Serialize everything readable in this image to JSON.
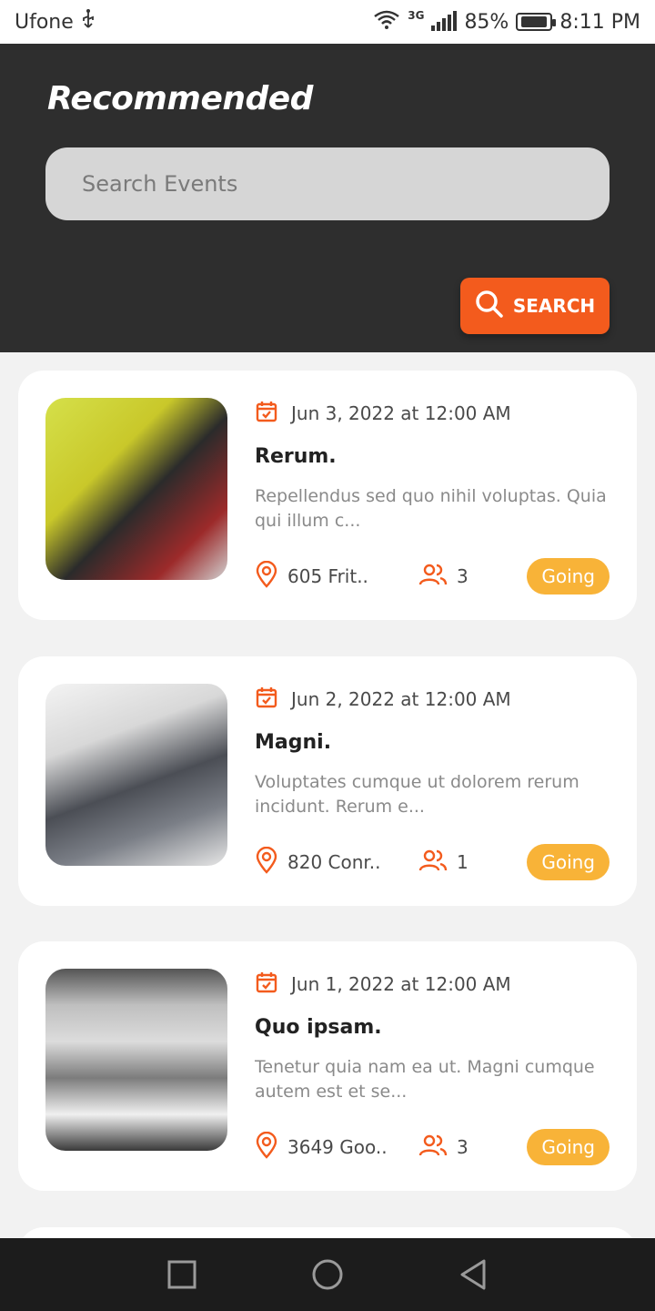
{
  "status_bar": {
    "carrier": "Ufone",
    "network": "3G",
    "battery": "85%",
    "time": "8:11 PM"
  },
  "header": {
    "title": "Recommended",
    "search_placeholder": "Search Events",
    "search_button": "SEARCH"
  },
  "events": [
    {
      "date": "Jun 3, 2022 at 12:00 AM",
      "title": "Rerum.",
      "description": "Repellendus sed quo nihil voluptas. Quia qui illum c...",
      "location": "605 Frit..",
      "attendees": "3",
      "status": "Going"
    },
    {
      "date": "Jun 2, 2022 at 12:00 AM",
      "title": "Magni.",
      "description": "Voluptates cumque ut dolorem rerum incidunt. Rerum e...",
      "location": "820 Conr..",
      "attendees": "1",
      "status": "Going"
    },
    {
      "date": "Jun 1, 2022 at 12:00 AM",
      "title": "Quo ipsam.",
      "description": "Tenetur quia nam ea ut. Magni cumque autem est et se...",
      "location": "3649 Goo..",
      "attendees": "3",
      "status": "Going"
    }
  ],
  "colors": {
    "accent": "#f35b1d",
    "badge": "#f8b338",
    "header_bg": "#2e2e2e"
  }
}
